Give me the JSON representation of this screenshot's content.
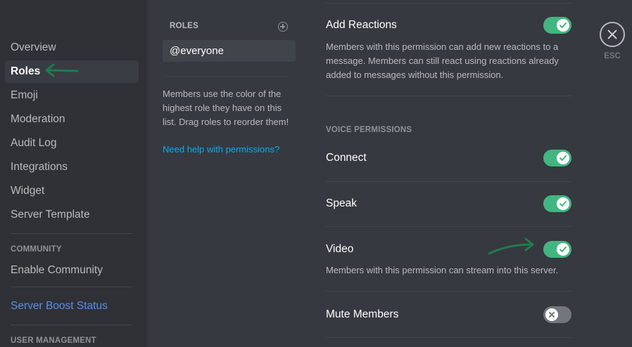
{
  "sidebar": {
    "items": [
      {
        "label": "Overview"
      },
      {
        "label": "Roles"
      },
      {
        "label": "Emoji"
      },
      {
        "label": "Moderation"
      },
      {
        "label": "Audit Log"
      },
      {
        "label": "Integrations"
      },
      {
        "label": "Widget"
      },
      {
        "label": "Server Template"
      }
    ],
    "community_header": "COMMUNITY",
    "community_items": [
      {
        "label": "Enable Community"
      }
    ],
    "boost_label": "Server Boost Status",
    "user_management_header": "USER MANAGEMENT"
  },
  "roles": {
    "header": "ROLES",
    "items": [
      {
        "name": "@everyone"
      }
    ],
    "help_text": "Members use the color of the highest role they have on this list. Drag roles to reorder them!",
    "help_link": "Need help with permissions?"
  },
  "permissions": {
    "add_reactions": {
      "title": "Add Reactions",
      "description": "Members with this permission can add new reactions to a message. Members can still react using reactions already added to messages without this permission.",
      "enabled": true
    },
    "voice_header": "VOICE PERMISSIONS",
    "connect": {
      "title": "Connect",
      "enabled": true
    },
    "speak": {
      "title": "Speak",
      "enabled": true
    },
    "video": {
      "title": "Video",
      "description": "Members with this permission can stream into this server.",
      "enabled": true
    },
    "mute_members": {
      "title": "Mute Members",
      "enabled": false
    }
  },
  "close": {
    "label": "ESC"
  },
  "colors": {
    "toggle_on": "#43b581",
    "toggle_off": "#72767d",
    "link": "#00aff4",
    "annotation_arrow": "#1e7d4c"
  }
}
